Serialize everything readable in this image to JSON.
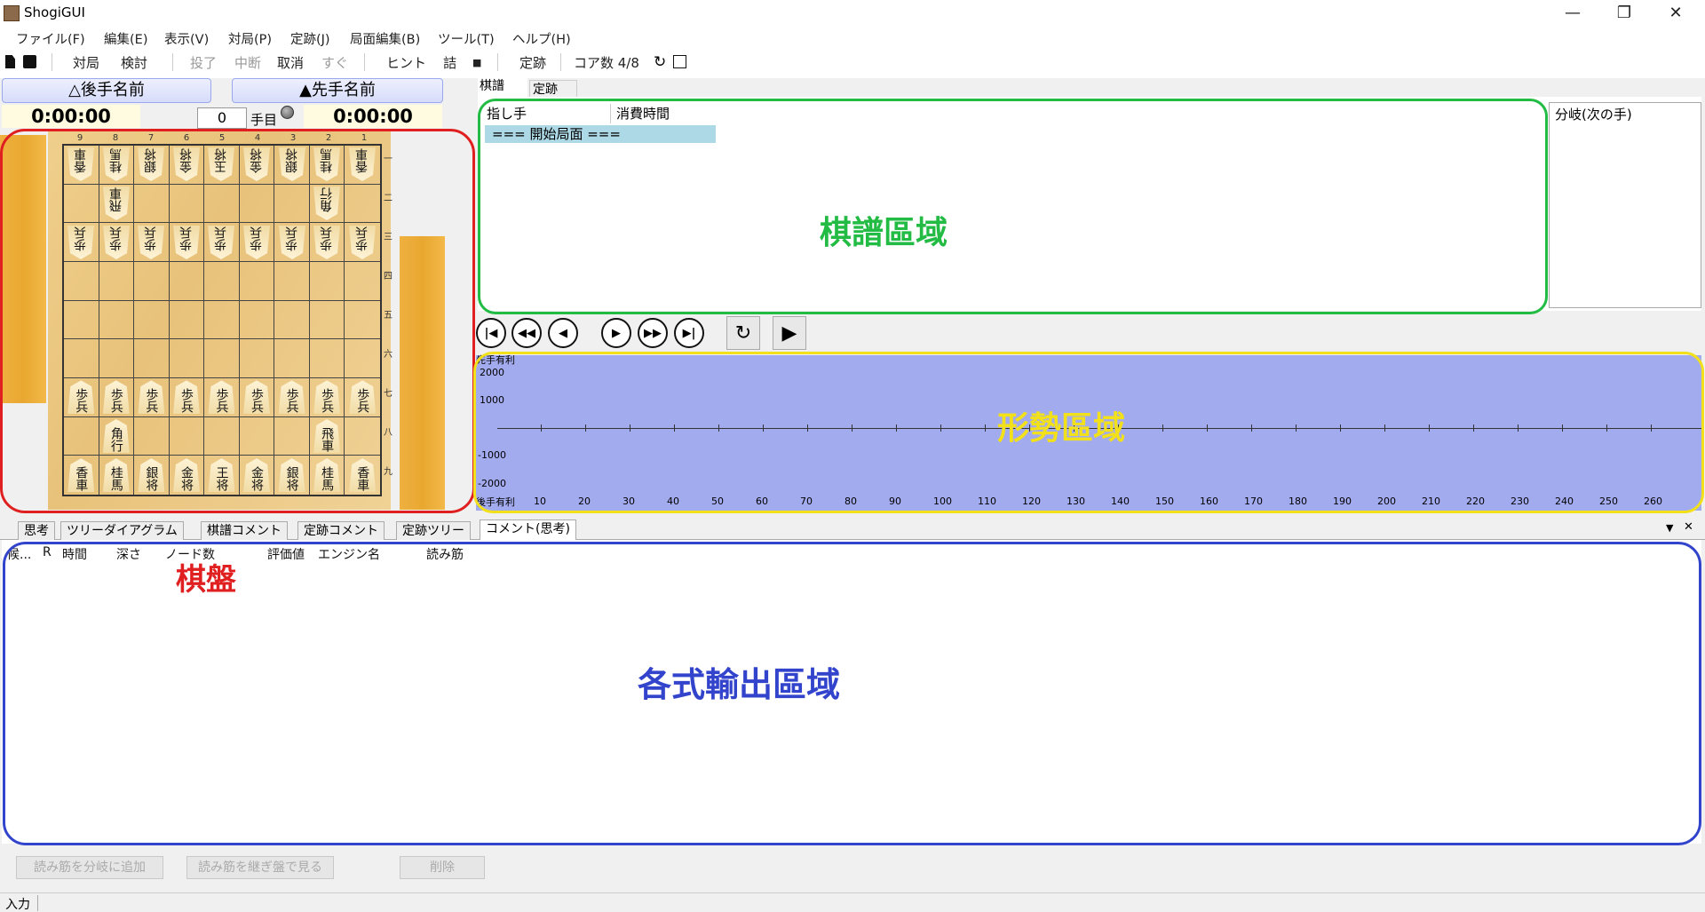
{
  "window": {
    "title": "ShogiGUI"
  },
  "menu": [
    "ファイル(F)",
    "編集(E)",
    "表示(V)",
    "対局(P)",
    "定跡(J)",
    "局面編集(B)",
    "ツール(T)",
    "ヘルプ(H)"
  ],
  "toolbar": {
    "taikyoku": "対局",
    "kento": "検討",
    "toryo": "投了",
    "chudan": "中断",
    "torikeshi": "取消",
    "sugu": "すぐ",
    "hint": "ヒント",
    "tsume": "詰",
    "stop": "■",
    "joseki": "定跡",
    "cores": "コア数 4/8"
  },
  "players": {
    "gote_name": "△後手名前",
    "sente_name": "▲先手名前",
    "gote_time": "0:00:00",
    "sente_time": "0:00:00",
    "move_number": "0",
    "move_unit": "手目"
  },
  "board": {
    "files": [
      "9",
      "8",
      "7",
      "6",
      "5",
      "4",
      "3",
      "2",
      "1"
    ],
    "ranks": [
      "一",
      "二",
      "三",
      "四",
      "五",
      "六",
      "七",
      "八",
      "九"
    ],
    "rows": [
      [
        {
          "t": "香車",
          "g": true
        },
        {
          "t": "桂馬",
          "g": true
        },
        {
          "t": "銀将",
          "g": true
        },
        {
          "t": "金将",
          "g": true
        },
        {
          "t": "玉将",
          "g": true
        },
        {
          "t": "金将",
          "g": true
        },
        {
          "t": "銀将",
          "g": true
        },
        {
          "t": "桂馬",
          "g": true
        },
        {
          "t": "香車",
          "g": true
        }
      ],
      [
        null,
        {
          "t": "飛車",
          "g": true
        },
        null,
        null,
        null,
        null,
        null,
        {
          "t": "角行",
          "g": true
        },
        null
      ],
      [
        {
          "t": "歩兵",
          "g": true
        },
        {
          "t": "歩兵",
          "g": true
        },
        {
          "t": "歩兵",
          "g": true
        },
        {
          "t": "歩兵",
          "g": true
        },
        {
          "t": "歩兵",
          "g": true
        },
        {
          "t": "歩兵",
          "g": true
        },
        {
          "t": "歩兵",
          "g": true
        },
        {
          "t": "歩兵",
          "g": true
        },
        {
          "t": "歩兵",
          "g": true
        }
      ],
      [
        null,
        null,
        null,
        null,
        null,
        null,
        null,
        null,
        null
      ],
      [
        null,
        null,
        null,
        null,
        null,
        null,
        null,
        null,
        null
      ],
      [
        null,
        null,
        null,
        null,
        null,
        null,
        null,
        null,
        null
      ],
      [
        {
          "t": "歩兵"
        },
        {
          "t": "歩兵"
        },
        {
          "t": "歩兵"
        },
        {
          "t": "歩兵"
        },
        {
          "t": "歩兵"
        },
        {
          "t": "歩兵"
        },
        {
          "t": "歩兵"
        },
        {
          "t": "歩兵"
        },
        {
          "t": "歩兵"
        }
      ],
      [
        null,
        {
          "t": "角行"
        },
        null,
        null,
        null,
        null,
        null,
        {
          "t": "飛車"
        },
        null
      ],
      [
        {
          "t": "香車"
        },
        {
          "t": "桂馬"
        },
        {
          "t": "銀将"
        },
        {
          "t": "金将"
        },
        {
          "t": "王将"
        },
        {
          "t": "金将"
        },
        {
          "t": "銀将"
        },
        {
          "t": "桂馬"
        },
        {
          "t": "香車"
        }
      ]
    ]
  },
  "annotations": {
    "board": "棋盤",
    "kifu": "棋譜區域",
    "graph": "形勢區域",
    "output": "各式輸出區域"
  },
  "kifu": {
    "tab1": "棋譜",
    "tab2": "定跡",
    "col_move": "指し手",
    "col_time": "消費時間",
    "start_row": "=== 開始局面 ===",
    "branch_header": "分岐(次の手)"
  },
  "graph": {
    "y_top": "先手有利",
    "y_bottom": "後手有利",
    "y_labels": [
      "2000",
      "1000",
      "-1000",
      "-2000"
    ],
    "x_labels": [
      "10",
      "20",
      "30",
      "40",
      "50",
      "60",
      "70",
      "80",
      "90",
      "100",
      "110",
      "120",
      "130",
      "140",
      "150",
      "160",
      "170",
      "180",
      "190",
      "200",
      "210",
      "220",
      "230",
      "240",
      "250",
      "260"
    ]
  },
  "bottom_tabs": [
    "思考",
    "ツリーダイアグラム",
    "棋譜コメント",
    "定跡コメント",
    "定跡ツリー",
    "コメント(思考)"
  ],
  "output_cols": [
    "候...",
    "R",
    "時間",
    "深さ",
    "ノード数",
    "評価値",
    "エンジン名",
    "読み筋"
  ],
  "buttons": {
    "add_branch": "読み筋を分岐に追加",
    "continue_board": "読み筋を継ぎ盤で見る",
    "delete": "削除"
  },
  "status": {
    "text": "入力"
  },
  "colors": {
    "board_annot": "#e02020",
    "kifu_annot": "#22bb44",
    "graph_annot": "#f2e01a",
    "output_annot": "#3344cc",
    "graph_bg": "#a3abef"
  }
}
